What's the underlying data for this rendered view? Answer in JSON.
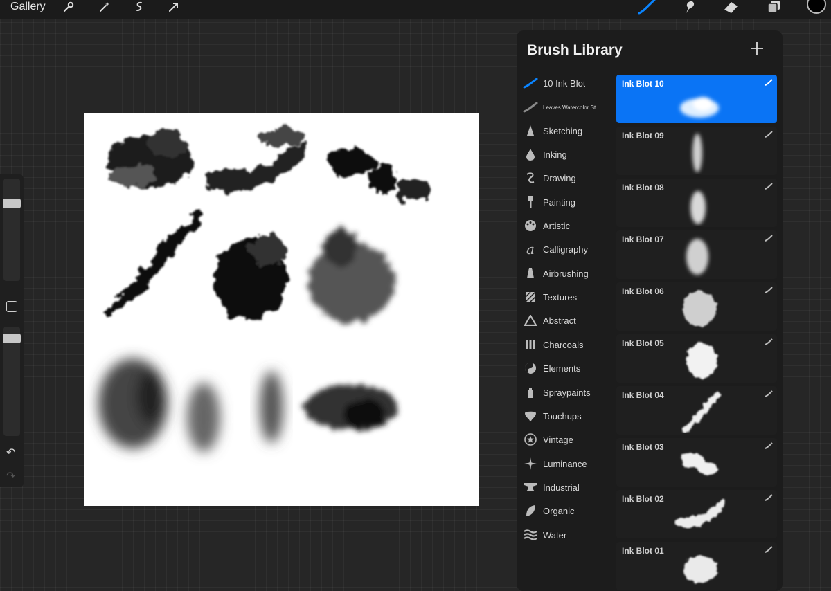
{
  "topbar": {
    "gallery_label": "Gallery",
    "left_tools": [
      "wrench-icon",
      "magic-wand-icon",
      "selection-icon",
      "move-arrow-icon"
    ],
    "right_tools": [
      "brush-icon",
      "smudge-icon",
      "eraser-icon",
      "layers-icon"
    ],
    "active_tool": "brush-icon",
    "current_color": "#000000",
    "accent_color": "#0a84ff"
  },
  "sidebar": {
    "size_slider_value": 0.78,
    "opacity_slider_value": 0.93
  },
  "brush_library": {
    "title": "Brush Library",
    "categories": [
      {
        "label": "10 Ink Blot",
        "icon": "custom-brush-icon",
        "selected": true
      },
      {
        "label": "Leaves Watercolor St...",
        "icon": "custom-brush-icon",
        "selected": false
      },
      {
        "label": "Sketching",
        "icon": "pencil-tip-icon",
        "selected": false
      },
      {
        "label": "Inking",
        "icon": "ink-drop-icon",
        "selected": false
      },
      {
        "label": "Drawing",
        "icon": "drawing-curl-icon",
        "selected": false
      },
      {
        "label": "Painting",
        "icon": "paintbrush-icon",
        "selected": false
      },
      {
        "label": "Artistic",
        "icon": "palette-icon",
        "selected": false
      },
      {
        "label": "Calligraphy",
        "icon": "calligraphy-icon",
        "selected": false
      },
      {
        "label": "Airbrushing",
        "icon": "airbrush-icon",
        "selected": false
      },
      {
        "label": "Textures",
        "icon": "texture-icon",
        "selected": false
      },
      {
        "label": "Abstract",
        "icon": "triangle-icon",
        "selected": false
      },
      {
        "label": "Charcoals",
        "icon": "charcoal-icon",
        "selected": false
      },
      {
        "label": "Elements",
        "icon": "yin-yang-icon",
        "selected": false
      },
      {
        "label": "Spraypaints",
        "icon": "spray-can-icon",
        "selected": false
      },
      {
        "label": "Touchups",
        "icon": "touchup-icon",
        "selected": false
      },
      {
        "label": "Vintage",
        "icon": "star-badge-icon",
        "selected": false
      },
      {
        "label": "Luminance",
        "icon": "sparkle-icon",
        "selected": false
      },
      {
        "label": "Industrial",
        "icon": "anvil-icon",
        "selected": false
      },
      {
        "label": "Organic",
        "icon": "leaf-icon",
        "selected": false
      },
      {
        "label": "Water",
        "icon": "waves-icon",
        "selected": false
      }
    ],
    "brushes": [
      {
        "name": "Ink Blot 10",
        "selected": true
      },
      {
        "name": "Ink Blot 09",
        "selected": false
      },
      {
        "name": "Ink Blot 08",
        "selected": false
      },
      {
        "name": "Ink Blot 07",
        "selected": false
      },
      {
        "name": "Ink Blot 06",
        "selected": false
      },
      {
        "name": "Ink Blot 05",
        "selected": false
      },
      {
        "name": "Ink Blot 04",
        "selected": false
      },
      {
        "name": "Ink Blot 03",
        "selected": false
      },
      {
        "name": "Ink Blot 02",
        "selected": false
      },
      {
        "name": "Ink Blot 01",
        "selected": false
      }
    ]
  }
}
